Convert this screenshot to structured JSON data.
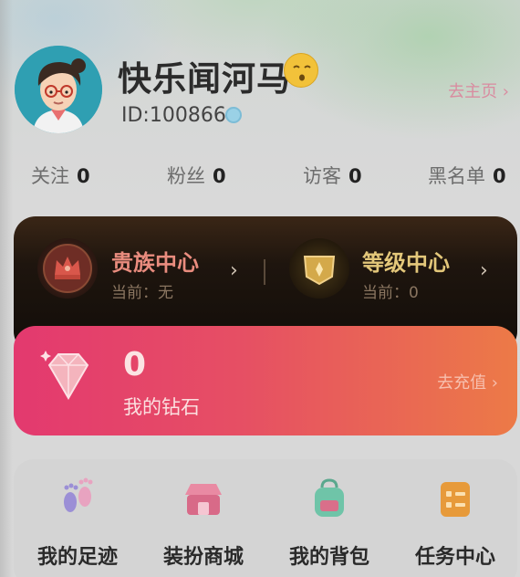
{
  "profile": {
    "username": "快乐闻河马",
    "user_id": "ID:100866",
    "homepage_link": "去主页 ›"
  },
  "stats": [
    {
      "label": "关注",
      "value": "0"
    },
    {
      "label": "粉丝",
      "value": "0"
    },
    {
      "label": "访客",
      "value": "0"
    },
    {
      "label": "黑名单",
      "value": "0"
    }
  ],
  "vip": {
    "nobility": {
      "title": "贵族中心",
      "current": "当前：无"
    },
    "level": {
      "title": "等级中心",
      "current": "当前：0"
    },
    "arrow": "›"
  },
  "diamond": {
    "count": "0",
    "label": "我的钻石",
    "recharge": "去充值 ›"
  },
  "menu": [
    {
      "label": "我的足迹",
      "icon": "footprint-icon"
    },
    {
      "label": "装扮商城",
      "icon": "shop-icon"
    },
    {
      "label": "我的背包",
      "icon": "backpack-icon"
    },
    {
      "label": "任务中心",
      "icon": "task-icon"
    }
  ],
  "colors": {
    "nobility_title": "#e98c7e",
    "level_title": "#e3c77a",
    "diamond_card_start": "#e3396f",
    "diamond_card_end": "#ec7a47"
  }
}
